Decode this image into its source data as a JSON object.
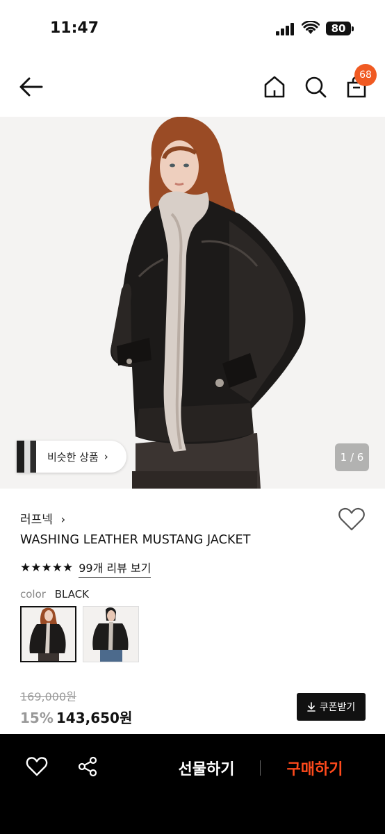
{
  "status_bar": {
    "time": "11:47",
    "battery": "80"
  },
  "header": {
    "cart_count": "68"
  },
  "gallery": {
    "similar_label": "비슷한 상품",
    "page_indicator": "1 / 6"
  },
  "product": {
    "brand": "러프넥",
    "name": "WASHING LEATHER MUSTANG JACKET",
    "stars": "★★★★★",
    "review_link": "99개 리뷰 보기",
    "color_label": "color",
    "color_value": "BLACK",
    "original_price": "169,000원",
    "discount": "15%",
    "sale_price": "143,650원",
    "coupon_label": "쿠폰받기"
  },
  "bottom_bar": {
    "gift_label": "선물하기",
    "buy_label": "구매하기"
  },
  "colors": {
    "accent": "#f05a22",
    "buy": "#ff4a1c"
  },
  "icons": [
    "back-arrow-icon",
    "home-icon",
    "search-icon",
    "shopping-bag-icon",
    "heart-icon",
    "share-icon",
    "chevron-right-icon",
    "download-icon"
  ]
}
